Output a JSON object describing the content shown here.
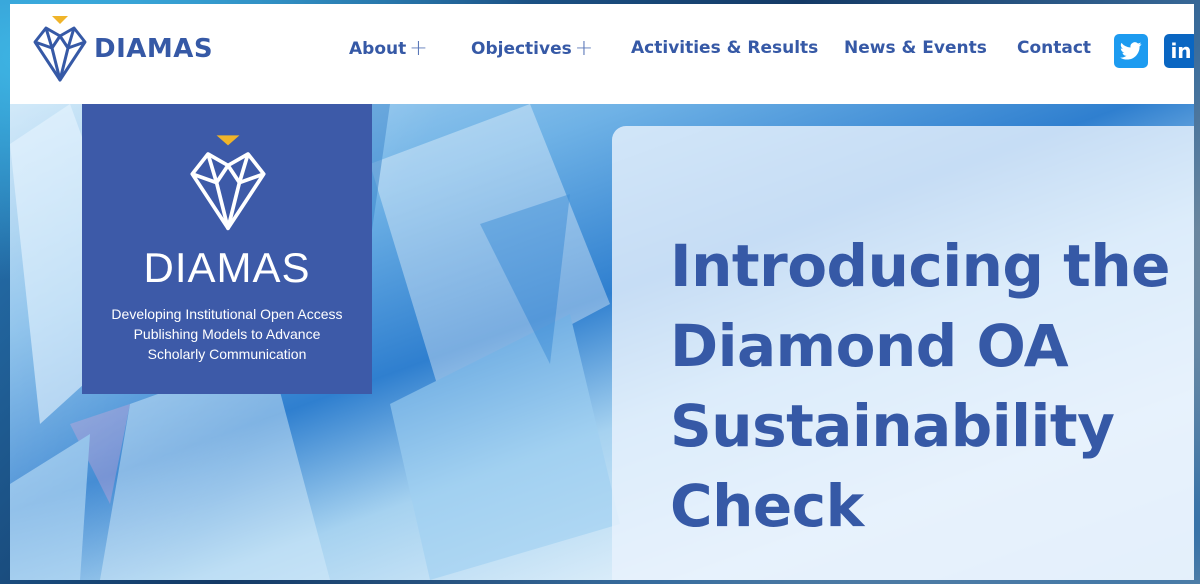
{
  "header": {
    "logo_text": "DIAMAS",
    "nav": [
      {
        "label": "About",
        "has_expand": true
      },
      {
        "label": "Objectives",
        "has_expand": true
      },
      {
        "label": "Activities & Results",
        "has_expand": false
      },
      {
        "label": "News & Events",
        "has_expand": false
      },
      {
        "label": "Contact",
        "has_expand": false
      }
    ],
    "expand_symbol": "+",
    "social": {
      "twitter_icon": "twitter-icon",
      "linkedin_label": "in"
    }
  },
  "brand_card": {
    "title": "DIAMAS",
    "subtitle_lines": [
      "Developing Institutional  Open Access",
      "Publishing Models to Advance",
      "Scholarly Communication"
    ]
  },
  "hero": {
    "headline_lines": [
      "Introducing the",
      "Diamond OA",
      "Sustainability",
      "Check"
    ]
  },
  "colors": {
    "brand_blue": "#3659a6",
    "card_blue": "#3d5aa8",
    "accent_gold": "#f0b429",
    "twitter": "#1d9bf0",
    "linkedin": "#0a66c2"
  }
}
